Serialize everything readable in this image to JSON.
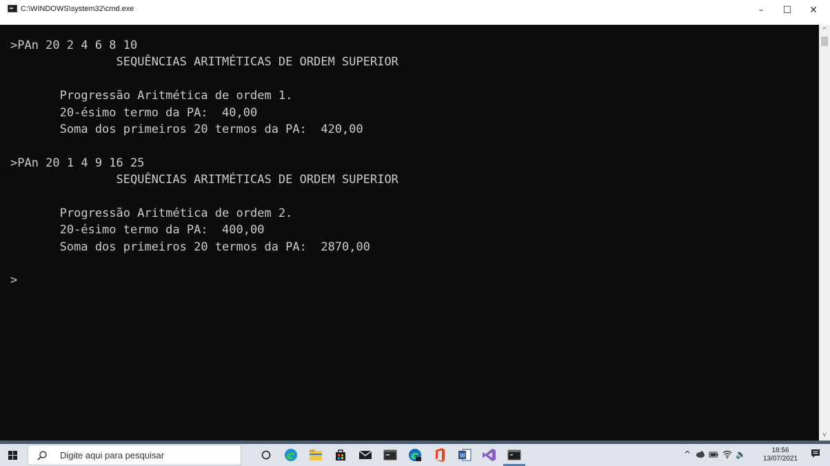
{
  "window": {
    "title": "C:\\WINDOWS\\system32\\cmd.exe",
    "minimize_glyph": "–",
    "maximize_glyph": "☐",
    "close_glyph": "✕"
  },
  "console": {
    "lines": [
      ">PAn 20 2 4 6 8 10",
      "               SEQUÊNCIAS ARITMÉTICAS DE ORDEM SUPERIOR",
      "",
      "       Progressão Aritmética de ordem 1.",
      "       20-ésimo termo da PA:  40,00",
      "       Soma dos primeiros 20 termos da PA:  420,00",
      "",
      ">PAn 20 1 4 9 16 25",
      "               SEQUÊNCIAS ARITMÉTICAS DE ORDEM SUPERIOR",
      "",
      "       Progressão Aritmética de ordem 2.",
      "       20-ésimo termo da PA:  400,00",
      "       Soma dos primeiros 20 termos da PA:  2870,00",
      "",
      ">"
    ]
  },
  "scrollbar": {
    "up_glyph": "^",
    "down_glyph": "v"
  },
  "taskbar": {
    "search_placeholder": "Digite aqui para pesquisar",
    "apps": [
      "cortana-icon",
      "edge-icon",
      "file-explorer-icon",
      "store-icon",
      "mail-icon",
      "terminal-icon",
      "edge-dev-icon",
      "office-icon",
      "word-icon",
      "visual-studio-icon",
      "cmd-icon"
    ],
    "tray": {
      "chevron": "^",
      "volume": "🔈",
      "time": "18:56",
      "date": "13/07/2021"
    }
  }
}
